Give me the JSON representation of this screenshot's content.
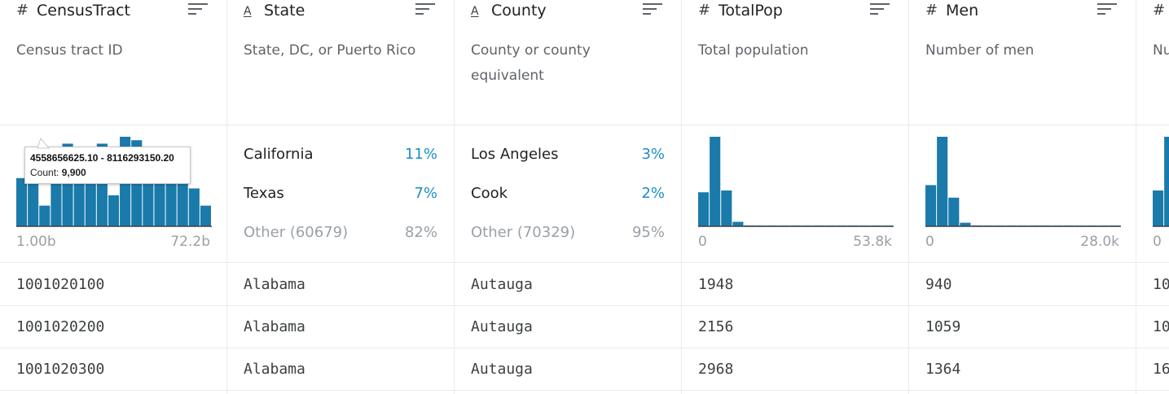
{
  "colors": {
    "bar": "#1a7aaa",
    "accent_pct": "#1a8fc4",
    "muted": "#9aa0a6",
    "border": "#e8eaed"
  },
  "columns": [
    {
      "type_icon": "#",
      "type": "numeric",
      "name": "CensusTract",
      "description": "Census tract ID",
      "histogram": [
        14,
        18,
        6,
        22,
        24,
        20,
        18,
        24,
        9,
        26,
        25,
        21,
        18,
        15,
        17,
        11,
        6
      ],
      "hist_min": "1.00b",
      "hist_max": "72.2b",
      "tooltip": {
        "range": "4558656625.10 - 8116293150.20",
        "count_label": "Count:",
        "count_value": "9,900"
      },
      "cells": [
        "1001020100",
        "1001020200",
        "1001020300"
      ]
    },
    {
      "type_icon": "A",
      "type": "string",
      "name": "State",
      "description": "State, DC, or Puerto Rico",
      "categories": [
        {
          "name": "California",
          "pct": "11%"
        },
        {
          "name": "Texas",
          "pct": "7%"
        },
        {
          "name": "Other (60679)",
          "pct": "82%"
        }
      ],
      "cells": [
        "Alabama",
        "Alabama",
        "Alabama"
      ]
    },
    {
      "type_icon": "A",
      "type": "string",
      "name": "County",
      "description": "County or county equivalent",
      "categories": [
        {
          "name": "Los Angeles",
          "pct": "3%"
        },
        {
          "name": "Cook",
          "pct": "2%"
        },
        {
          "name": "Other (70329)",
          "pct": "95%"
        }
      ],
      "cells": [
        "Autauga",
        "Autauga",
        "Autauga"
      ]
    },
    {
      "type_icon": "#",
      "type": "numeric",
      "name": "TotalPop",
      "description": "Total population",
      "histogram": [
        38,
        100,
        40,
        5,
        1,
        0.6,
        0.4,
        0.3,
        0.2,
        0.2,
        0.1,
        0.1,
        0.1,
        0.1,
        0.1,
        0.1,
        0.1
      ],
      "hist_min": "0",
      "hist_max": "53.8k",
      "cells": [
        "1948",
        "2156",
        "2968"
      ]
    },
    {
      "type_icon": "#",
      "type": "numeric",
      "name": "Men",
      "description": "Number of men",
      "histogram": [
        46,
        100,
        32,
        4,
        1,
        0.6,
        0.4,
        0.3,
        0.2,
        0.2,
        0.1,
        0.1,
        0.1,
        0.1,
        0.1,
        0.1,
        0.1
      ],
      "hist_min": "0",
      "hist_max": "28.0k",
      "cells": [
        "940",
        "1059",
        "1364"
      ]
    },
    {
      "type_icon": "#",
      "type": "numeric",
      "name": "",
      "description": "Nu",
      "histogram": [
        40,
        100
      ],
      "hist_min": "0",
      "hist_max": "",
      "cells": [
        "10",
        "10",
        "16"
      ]
    }
  ]
}
